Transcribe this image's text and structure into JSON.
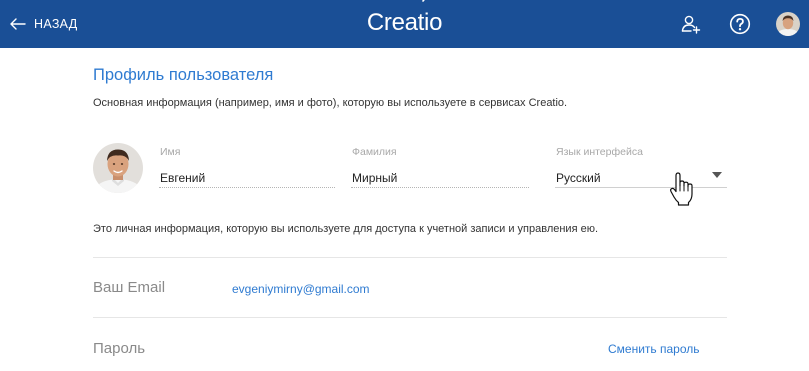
{
  "colors": {
    "topbar": "#1a4f96",
    "accent": "#2f7bd1",
    "label": "#a8a8a8",
    "text": "#333333"
  },
  "header": {
    "back_label": "НАЗАД",
    "logo_text_before": "Creat",
    "logo_text_after": "io",
    "icons": [
      "back-arrow-icon",
      "add-user-icon",
      "help-icon",
      "user-avatar"
    ]
  },
  "profile": {
    "title": "Профиль пользователя",
    "description": "Основная информация (например, имя и фото), которую вы используете в сервисах Creatio.",
    "fields": {
      "first_name": {
        "label": "Имя",
        "value": "Евгений"
      },
      "last_name": {
        "label": "Фамилия",
        "value": "Мирный"
      },
      "language": {
        "label": "Язык интерфейса",
        "value": "Русский"
      }
    },
    "personal_info_note": "Это личная информация, которую вы используете для доступа к учетной записи и управления ею."
  },
  "account": {
    "email_label": "Ваш Email",
    "email_value": "evgeniymirny@gmail.com",
    "password_label": "Пароль",
    "change_password_label": "Сменить пароль"
  }
}
